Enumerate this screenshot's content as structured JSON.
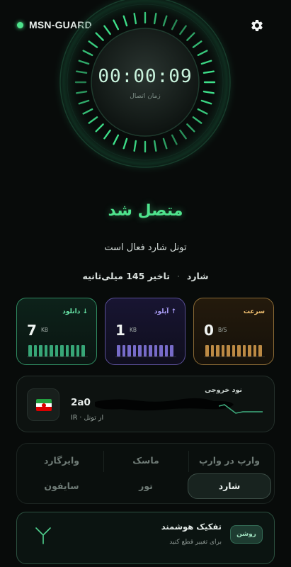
{
  "app": {
    "name": "MSN-GUARD"
  },
  "icons": {
    "settings": "gear-icon",
    "fork": "fork-icon"
  },
  "colors": {
    "accent": "#4fe38d",
    "download": "#69e6a8",
    "upload": "#a99cf5",
    "speed": "#f1c071"
  },
  "timer": {
    "value": "00:00:09",
    "label": "زمان اتصال"
  },
  "status": {
    "title": "متصل شد",
    "subtitle": "تونل شارد فعال است",
    "protocol": "شارد",
    "separator": "·",
    "latency": "تاخیر 145 میلی‌ثانیه"
  },
  "stats": {
    "speed": {
      "label": "سرعت",
      "value": "0",
      "unit": "B/S"
    },
    "upload": {
      "label": "↑ آپلود",
      "value": "1",
      "unit": "KB"
    },
    "download": {
      "label": "↓ دانلود",
      "value": "7",
      "unit": "KB"
    }
  },
  "node": {
    "label": "نود خروجی",
    "address": "2a0",
    "from": "از تونل · IR",
    "flag": "Iran"
  },
  "protocols": {
    "row1": [
      "وارپ در وارپ",
      "ماسک",
      "وایرگارد"
    ],
    "row2": [
      "شارد",
      "تور",
      "سایفون"
    ],
    "active": "شارد"
  },
  "smart_split": {
    "title": "تفکیک هوشمند",
    "description": "برای تغییر قطع کنید",
    "toggle_label": "روشن"
  }
}
